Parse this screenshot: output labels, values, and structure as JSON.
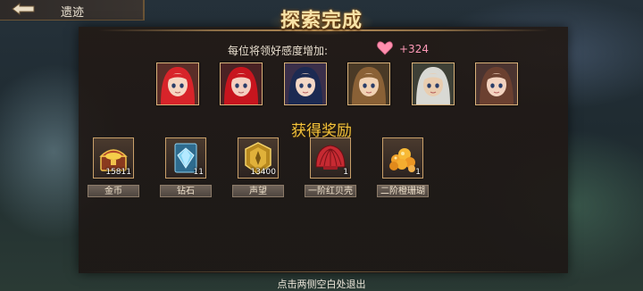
{
  "header": {
    "tab_title": "遗迹",
    "back_icon": "back-arrow-icon"
  },
  "title": "探索完成",
  "affinity": {
    "label": "每位将领好感度增加:",
    "value": "+324",
    "icon": "heart-icon",
    "color": "#ff8fae"
  },
  "heroes": [
    {
      "name": "hero-1",
      "hair": "#d8242a",
      "skin": "#f6d6c2",
      "bg": "#5a2e28"
    },
    {
      "name": "hero-2",
      "hair": "#c8151e",
      "skin": "#f4cfc0",
      "bg": "#4a2224"
    },
    {
      "name": "hero-3",
      "hair": "#1c2a52",
      "skin": "#f4d8c6",
      "bg": "#3a2f4a"
    },
    {
      "name": "hero-4",
      "hair": "#8a6136",
      "skin": "#f1d2b4",
      "bg": "#4a3a26"
    },
    {
      "name": "hero-5",
      "hair": "#d9d9d4",
      "skin": "#e9cdb0",
      "bg": "#3e4036"
    },
    {
      "name": "hero-6",
      "hair": "#6b4030",
      "skin": "#f3d3c0",
      "bg": "#4b3430"
    }
  ],
  "rewards_title": "获得奖励",
  "rewards": [
    {
      "name": "金币",
      "qty": "15811",
      "icon": "gold-chest-icon"
    },
    {
      "name": "钻石",
      "qty": "11",
      "icon": "diamond-icon"
    },
    {
      "name": "声望",
      "qty": "13400",
      "icon": "prestige-icon"
    },
    {
      "name": "一阶红贝壳",
      "qty": "1",
      "icon": "red-shell-icon"
    },
    {
      "name": "二阶橙珊瑚",
      "qty": "1",
      "icon": "orange-coral-icon"
    }
  ],
  "exit_hint": "点击两侧空白处退出"
}
